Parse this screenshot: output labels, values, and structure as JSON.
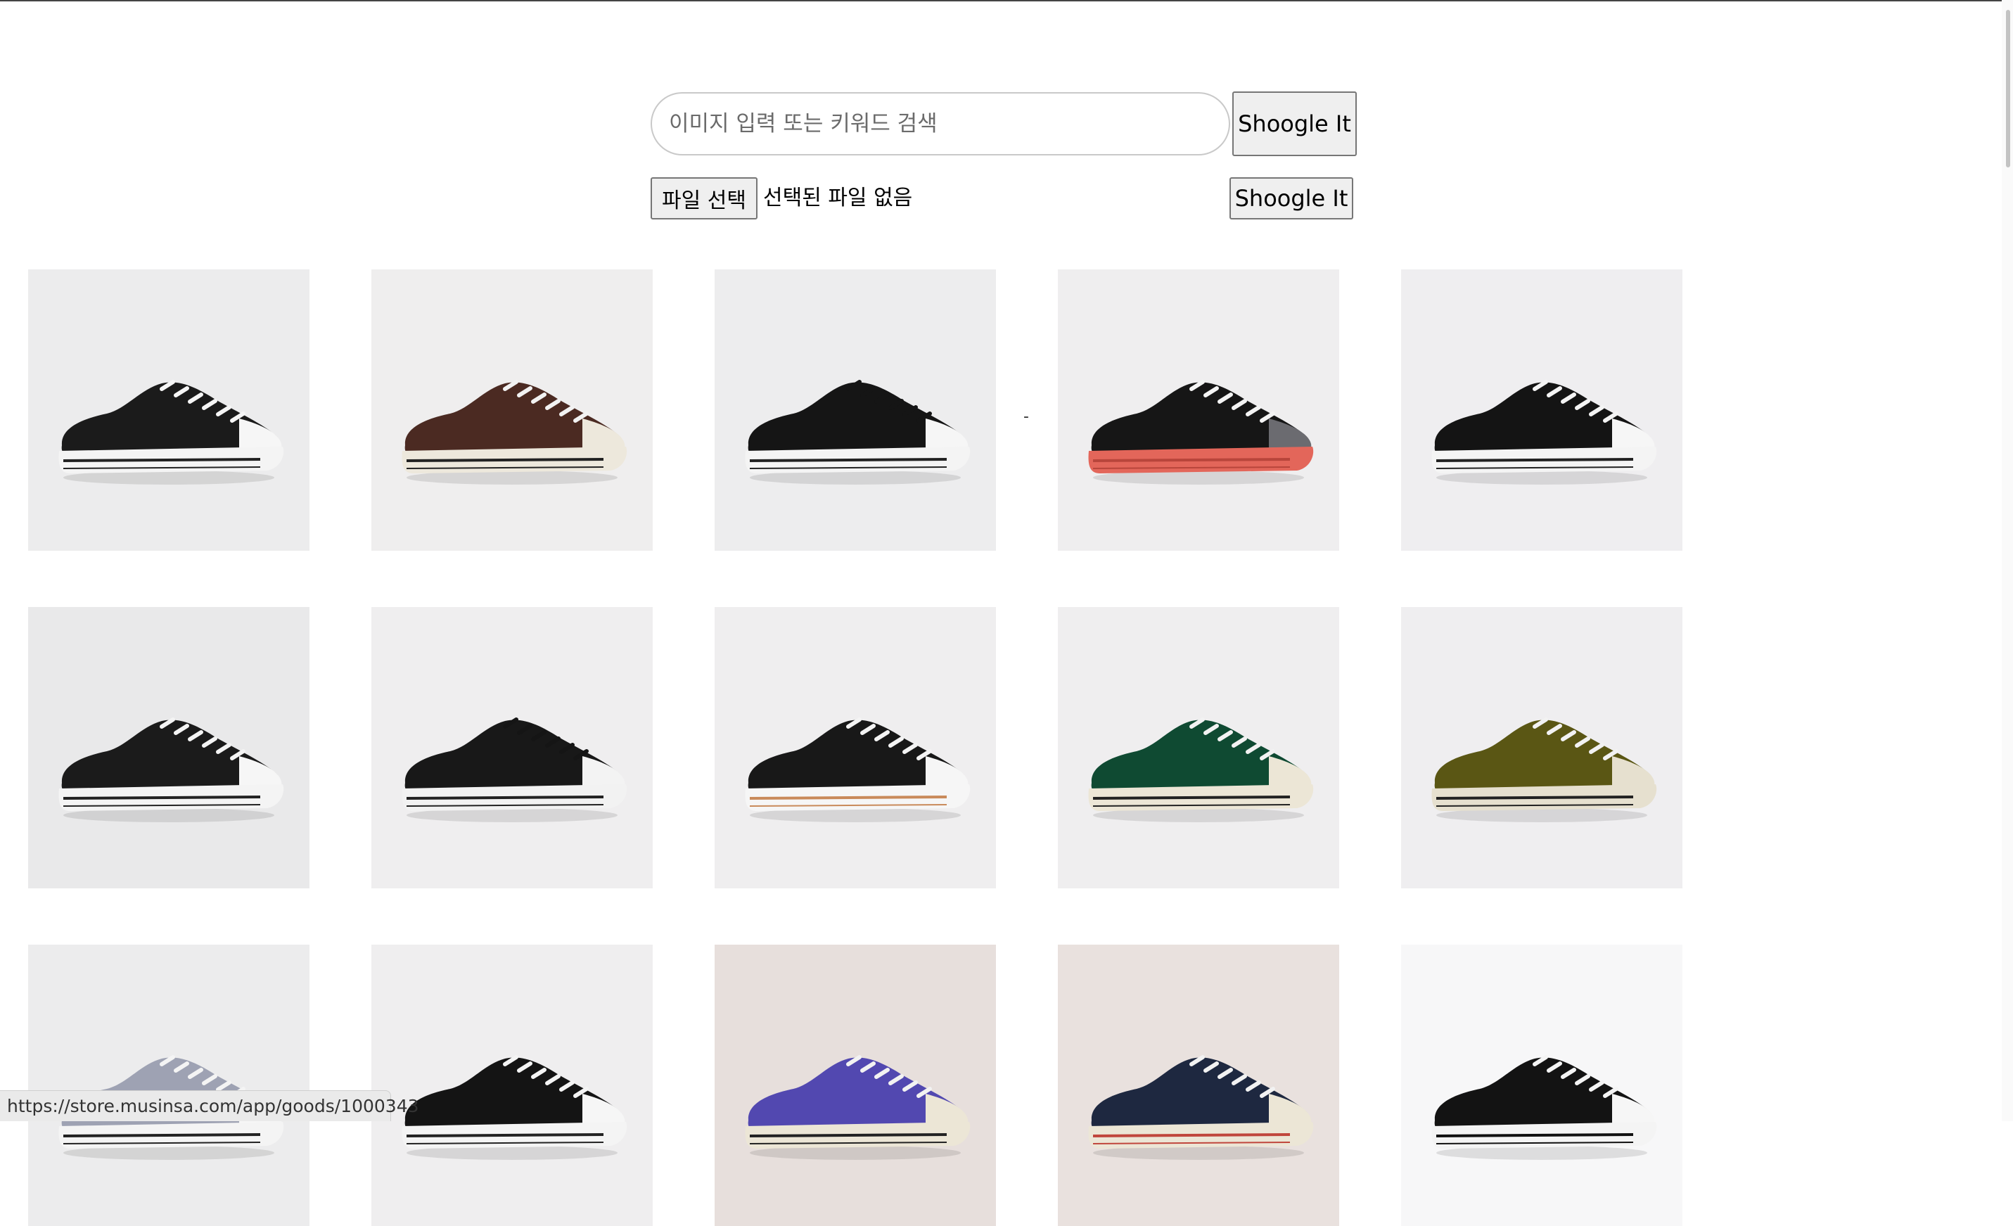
{
  "search": {
    "placeholder": "이미지 입력 또는 키워드 검색",
    "value": "",
    "button_label": "Shoogle It"
  },
  "upload": {
    "choose_file_label": "파일 선택",
    "file_status": "선택된 파일 없음",
    "button_label": "Shoogle It"
  },
  "separator_text": "-",
  "status_bar": {
    "url": "https://store.musinsa.com/app/goods/1000343"
  },
  "products": [
    {
      "name": "product-black-low-top",
      "bg": "#ececed",
      "upper": "#1b1b1b",
      "sole": "#f4f4f4",
      "stripe": "#222222",
      "toe": "#f6f6f6",
      "laces": "#f6f6f6"
    },
    {
      "name": "product-brown-low-top",
      "bg": "#efeeee",
      "upper": "#4b2a22",
      "sole": "#ede8dc",
      "stripe": "#222222",
      "toe": "#ede8dc",
      "laces": "#f2f2f2"
    },
    {
      "name": "product-black-slip-on",
      "bg": "#ededee",
      "upper": "#151515",
      "sole": "#f4f4f4",
      "stripe": "#222222",
      "toe": "#f6f6f6",
      "laces": "#151515"
    },
    {
      "name": "product-black-translucent-red-sole",
      "bg": "#efeeef",
      "upper": "#161616",
      "sole": "#e3665a",
      "stripe": "#b8453b",
      "toe": "#6b6b70",
      "laces": "#f4f4f4"
    },
    {
      "name": "product-black-monochrome-low-top",
      "bg": "#efeef0",
      "upper": "#141414",
      "sole": "#f4f4f4",
      "stripe": "#222222",
      "toe": "#f6f6f6",
      "laces": "#f4f4f4"
    },
    {
      "name": "product-black-shoreline",
      "bg": "#e9e9ea",
      "upper": "#1b1b1b",
      "sole": "#f4f4f4",
      "stripe": "#222222",
      "toe": "#f6f6f6",
      "laces": "#f4f4f4"
    },
    {
      "name": "product-black-platform",
      "bg": "#efeeef",
      "upper": "#181818",
      "sole": "#f2f2f2",
      "stripe": "#222222",
      "toe": "#f3f3f3",
      "laces": "#151515"
    },
    {
      "name": "product-black-move-platform",
      "bg": "#efeeef",
      "upper": "#181818",
      "sole": "#f6f6f6",
      "stripe": "#c98a5a",
      "toe": "#f6f6f6",
      "laces": "#f4f4f4"
    },
    {
      "name": "product-green-low-top",
      "bg": "#efeeef",
      "upper": "#0f4a32",
      "sole": "#ece6d6",
      "stripe": "#222222",
      "toe": "#ece6d6",
      "laces": "#f2f2f2"
    },
    {
      "name": "product-olive-low-top",
      "bg": "#efeef0",
      "upper": "#5a5614",
      "sole": "#e6e0cf",
      "stripe": "#222222",
      "toe": "#e6e0cf",
      "laces": "#f2f2f2"
    },
    {
      "name": "product-grey-low-top",
      "bg": "#ececed",
      "upper": "#9ea2b3",
      "sole": "#f4f4f4",
      "stripe": "#222222",
      "toe": "#f6f6f6",
      "laces": "#f4f4f4"
    },
    {
      "name": "product-black-low-top-2",
      "bg": "#efeeef",
      "upper": "#141414",
      "sole": "#f4f4f4",
      "stripe": "#222222",
      "toe": "#f6f6f6",
      "laces": "#f4f4f4"
    },
    {
      "name": "product-purple-low-top",
      "bg": "#e7dfdc",
      "upper": "#5248b0",
      "sole": "#ece6d6",
      "stripe": "#222222",
      "toe": "#ece6d6",
      "laces": "#f2f2f2"
    },
    {
      "name": "product-navy-pattern-low-top",
      "bg": "#e9e1de",
      "upper": "#1e2840",
      "sole": "#ece6d6",
      "stripe": "#c0463c",
      "toe": "#ece6d6",
      "laces": "#f2f2f2"
    },
    {
      "name": "product-black-white-low-top",
      "bg": "#f7f7f8",
      "upper": "#131313",
      "sole": "#f4f4f4",
      "stripe": "#111111",
      "toe": "#f6f6f6",
      "laces": "#f4f4f4"
    }
  ]
}
